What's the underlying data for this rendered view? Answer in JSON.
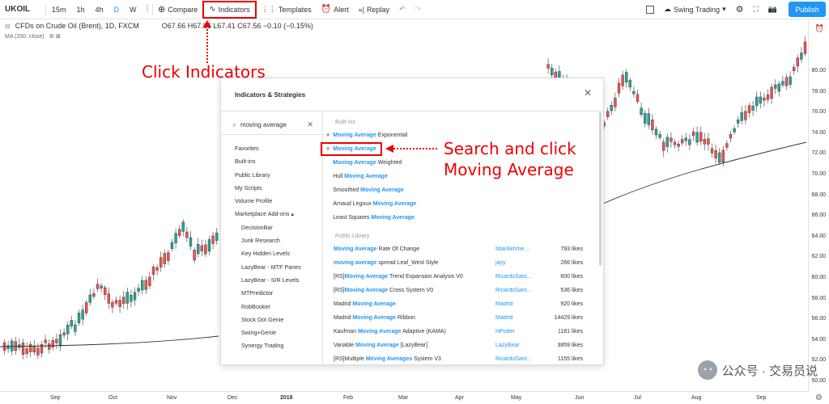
{
  "toolbar": {
    "symbol": "UKOIL",
    "intervals": [
      "15m",
      "1h",
      "4h",
      "D",
      "W"
    ],
    "compare": "Compare",
    "indicators": "Indicators",
    "templates": "Templates",
    "alert": "Alert",
    "replay": "Replay",
    "layout": "Swing Trading",
    "publish": "Publish"
  },
  "legend": {
    "title": "CFDs on Crude Oil (Brent), 1D, FXCM",
    "ohlc": "O67.66  H67.86  L67.41  C67.56  −0.10 (−0.15%)",
    "ma": "MA (200, close)"
  },
  "yaxis": [
    "80.00",
    "78.00",
    "76.00",
    "74.00",
    "72.00",
    "70.00",
    "68.00",
    "66.00",
    "64.00",
    "62.00",
    "60.00",
    "58.00",
    "56.00",
    "54.00",
    "52.00",
    "50.00"
  ],
  "xaxis": [
    "Sep",
    "Oct",
    "Nov",
    "Dec",
    "2018",
    "Feb",
    "Mar",
    "Apr",
    "May",
    "Jun",
    "Jul",
    "Aug",
    "Sep"
  ],
  "dialog": {
    "title": "Indicators & Strategies",
    "search_value": "moving average",
    "categories": [
      "Favorites",
      "Built-ins",
      "Public Library",
      "My Scripts",
      "Volume Profile",
      "Marketplace Add-ons ▴"
    ],
    "addons": [
      "DecisionBar",
      "Jurik Research",
      "Key Hidden Levels",
      "LazyBear - MTF Panes",
      "LazyBear - S/R Levels",
      "MTPredictor",
      "RobBooker",
      "Stock Dot Genie",
      "Swing+Genie",
      "Synergy Trading"
    ],
    "builtins_label": "Built-ins",
    "builtins": [
      {
        "pre": "",
        "hl": "Moving Average",
        "post": " Exponential",
        "star": true
      },
      {
        "pre": "",
        "hl": "Moving Average",
        "post": "",
        "star": true
      },
      {
        "pre": "",
        "hl": "Moving Average",
        "post": " Weighted",
        "star": false
      },
      {
        "pre": "Hull ",
        "hl": "Moving Average",
        "post": "",
        "star": false
      },
      {
        "pre": "Smoothed ",
        "hl": "Moving Average",
        "post": "",
        "star": false
      },
      {
        "pre": "Arnaud Legoux ",
        "hl": "Moving Average",
        "post": "",
        "star": false
      },
      {
        "pre": "Least Squares ",
        "hl": "Moving Average",
        "post": "",
        "star": false
      }
    ],
    "public_label": "Public Library",
    "public": [
      {
        "pre": "",
        "hl": "Moving Average",
        "post": " Rate Of Change",
        "author": "IldarAkhme...",
        "likes": "793 likes"
      },
      {
        "pre": "",
        "hl": "moving average",
        "post": " spread Leaf_West Style",
        "author": "jayy",
        "likes": "266 likes"
      },
      {
        "pre": "[RS]",
        "hl": "Moving Average",
        "post": " Trend Expansion Analysis V0",
        "author": "RicardoSant...",
        "likes": "600 likes"
      },
      {
        "pre": "[RS]",
        "hl": "Moving Average",
        "post": " Cross System V0",
        "author": "RicardoSant...",
        "likes": "536 likes"
      },
      {
        "pre": "Madrid ",
        "hl": "Moving Average",
        "post": "",
        "author": "Madrid",
        "likes": "920 likes"
      },
      {
        "pre": "Madrid ",
        "hl": "Moving Average",
        "post": " Ribbon",
        "author": "Madrid",
        "likes": "14429 likes"
      },
      {
        "pre": "Kaufman ",
        "hl": "Moving Average",
        "post": " Adaptive (KAMA)",
        "author": "HPotter",
        "likes": "1181 likes"
      },
      {
        "pre": "Variable ",
        "hl": "Moving Average",
        "post": " [LazyBear]",
        "author": "LazyBear",
        "likes": "3859 likes"
      },
      {
        "pre": "[RS]Multiple ",
        "hl": "Moving Averages",
        "post": " System V3",
        "author": "RicardoSant...",
        "likes": "1155 likes"
      }
    ]
  },
  "annotations": {
    "click_indicators": "Click Indicators",
    "search_line1": "Search and click",
    "search_line2": "Moving Average"
  },
  "watermark": "公众号 · 交易员说",
  "colors": {
    "up": "#26a69a",
    "down": "#ef5350",
    "accent": "#2196f3",
    "annotation": "#e00000"
  }
}
